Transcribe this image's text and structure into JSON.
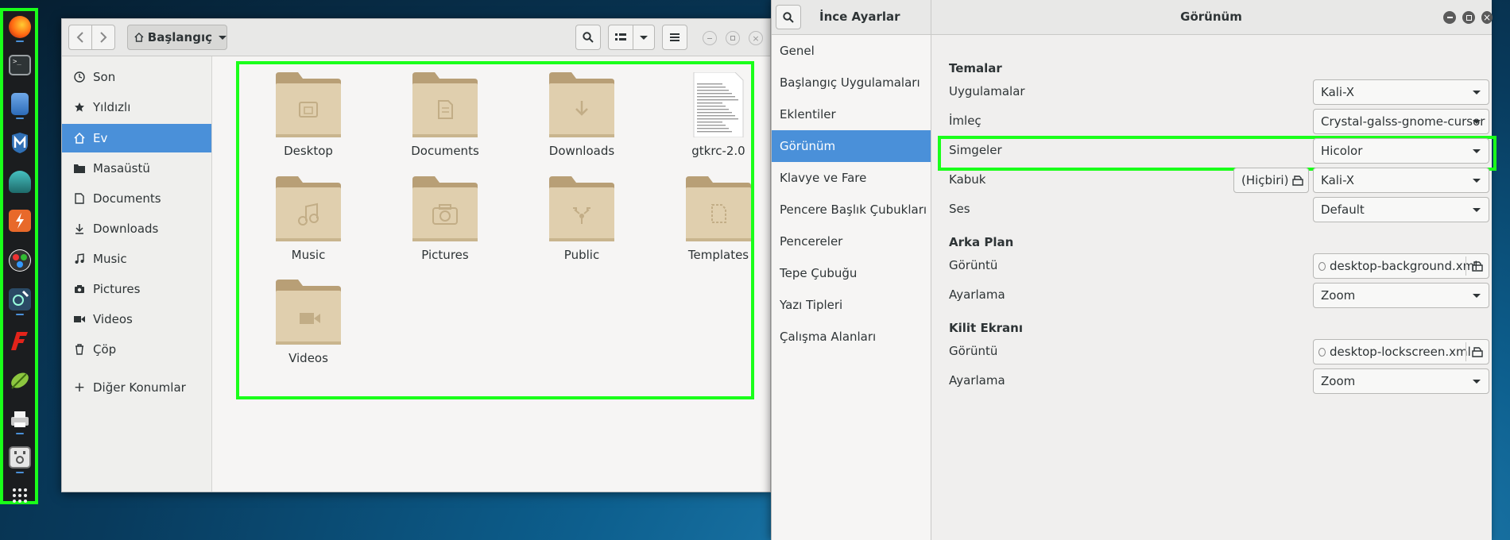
{
  "dock": {
    "apps": [
      {
        "name": "firefox-icon",
        "color": "#e66000"
      },
      {
        "name": "terminal-icon",
        "color": "#2e3436"
      },
      {
        "name": "file-manager-icon",
        "color": "#3d7cc9"
      },
      {
        "name": "metasploit-icon",
        "color": "#3470b5"
      },
      {
        "name": "armitage-icon",
        "color": "#2f8f8f"
      },
      {
        "name": "burpsuite-icon",
        "color": "#e8692a"
      },
      {
        "name": "maltego-icon",
        "color": "#2b2b2b"
      },
      {
        "name": "beef-icon",
        "color": "#3a6fa0"
      },
      {
        "name": "faraday-icon",
        "color": "#d22"
      },
      {
        "name": "leafpad-icon",
        "color": "#7ab13b"
      },
      {
        "name": "printer-icon",
        "color": "#aaa"
      },
      {
        "name": "settings-tool-icon",
        "color": "#ddd"
      }
    ],
    "show_apps": "apps-grid-icon"
  },
  "files": {
    "location": "Başlangıç",
    "sidebar": [
      {
        "label": "Son",
        "icon": "clock-icon"
      },
      {
        "label": "Yıldızlı",
        "icon": "star-icon"
      },
      {
        "label": "Ev",
        "icon": "home-icon",
        "active": true
      },
      {
        "label": "Masaüstü",
        "icon": "desktop-folder-icon"
      },
      {
        "label": "Documents",
        "icon": "document-icon"
      },
      {
        "label": "Downloads",
        "icon": "download-icon"
      },
      {
        "label": "Music",
        "icon": "music-icon"
      },
      {
        "label": "Pictures",
        "icon": "camera-icon"
      },
      {
        "label": "Videos",
        "icon": "video-icon"
      },
      {
        "label": "Çöp",
        "icon": "trash-icon"
      },
      {
        "label": "Diğer Konumlar",
        "icon": "plus-icon"
      }
    ],
    "items": [
      {
        "label": "Desktop",
        "type": "folder",
        "emblem": "desktop"
      },
      {
        "label": "Documents",
        "type": "folder",
        "emblem": "documents"
      },
      {
        "label": "Downloads",
        "type": "folder",
        "emblem": "downloads"
      },
      {
        "label": "gtkrc-2.0",
        "type": "file",
        "emblem": "text"
      },
      {
        "label": "Music",
        "type": "folder",
        "emblem": "music"
      },
      {
        "label": "Pictures",
        "type": "folder",
        "emblem": "pictures"
      },
      {
        "label": "Public",
        "type": "folder",
        "emblem": "public"
      },
      {
        "label": "Templates",
        "type": "folder",
        "emblem": "templates"
      },
      {
        "label": "Videos",
        "type": "folder",
        "emblem": "videos"
      }
    ]
  },
  "tweaks": {
    "app_title": "İnce Ayarlar",
    "panel_title": "Görünüm",
    "sidebar": [
      {
        "label": "Genel"
      },
      {
        "label": "Başlangıç Uygulamaları"
      },
      {
        "label": "Eklentiler"
      },
      {
        "label": "Görünüm",
        "active": true
      },
      {
        "label": "Klavye ve Fare"
      },
      {
        "label": "Pencere Başlık Çubukları"
      },
      {
        "label": "Pencereler"
      },
      {
        "label": "Tepe Çubuğu"
      },
      {
        "label": "Yazı Tipleri"
      },
      {
        "label": "Çalışma Alanları"
      }
    ],
    "themes": {
      "heading": "Temalar",
      "applications": {
        "label": "Uygulamalar",
        "value": "Kali-X"
      },
      "cursor": {
        "label": "İmleç",
        "value": "Crystal-galss-gnome-cursor"
      },
      "icons": {
        "label": "Simgeler",
        "value": "Hicolor"
      },
      "shell": {
        "label": "Kabuk",
        "value": "Kali-X",
        "none_label": "(Hiçbiri)"
      },
      "sound": {
        "label": "Ses",
        "value": "Default"
      }
    },
    "background": {
      "heading": "Arka Plan",
      "image": {
        "label": "Görüntü",
        "value": "desktop-background.xml"
      },
      "adjust": {
        "label": "Ayarlama",
        "value": "Zoom"
      }
    },
    "lockscreen": {
      "heading": "Kilit Ekranı",
      "image": {
        "label": "Görüntü",
        "value": "desktop-lockscreen.xml"
      },
      "adjust": {
        "label": "Ayarlama",
        "value": "Zoom"
      }
    }
  },
  "colors": {
    "highlight": "#1aff1a",
    "accent": "#4a90d9",
    "folder": "#dcc8a0"
  }
}
